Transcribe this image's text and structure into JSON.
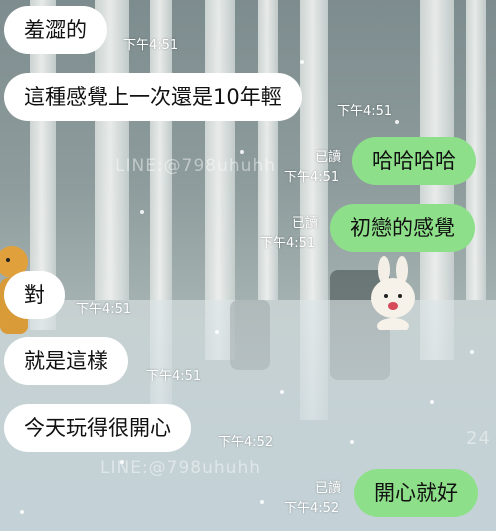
{
  "messages": [
    {
      "text": "羞澀的",
      "time": "下午4:51"
    },
    {
      "text": "這種感覺上一次還是10年輕",
      "time": "下午4:51"
    },
    {
      "text": "哈哈哈哈",
      "time": "下午4:51",
      "read": "已讀"
    },
    {
      "text": "初戀的感覺",
      "time": "下午4:51",
      "read": "已讀"
    },
    {
      "text": "對",
      "time": "下午4:51"
    },
    {
      "text": "就是這樣",
      "time": "下午4:51"
    },
    {
      "text": "今天玩得很開心",
      "time": "下午4:52"
    },
    {
      "text": "開心就好",
      "time": "下午4:52",
      "read": "已讀"
    }
  ],
  "watermarks": [
    "LINE:@798uhuhh",
    "LINE:@798uhuhh",
    "24"
  ],
  "colors": {
    "incoming": "#ffffff",
    "outgoing": "#8de089"
  }
}
